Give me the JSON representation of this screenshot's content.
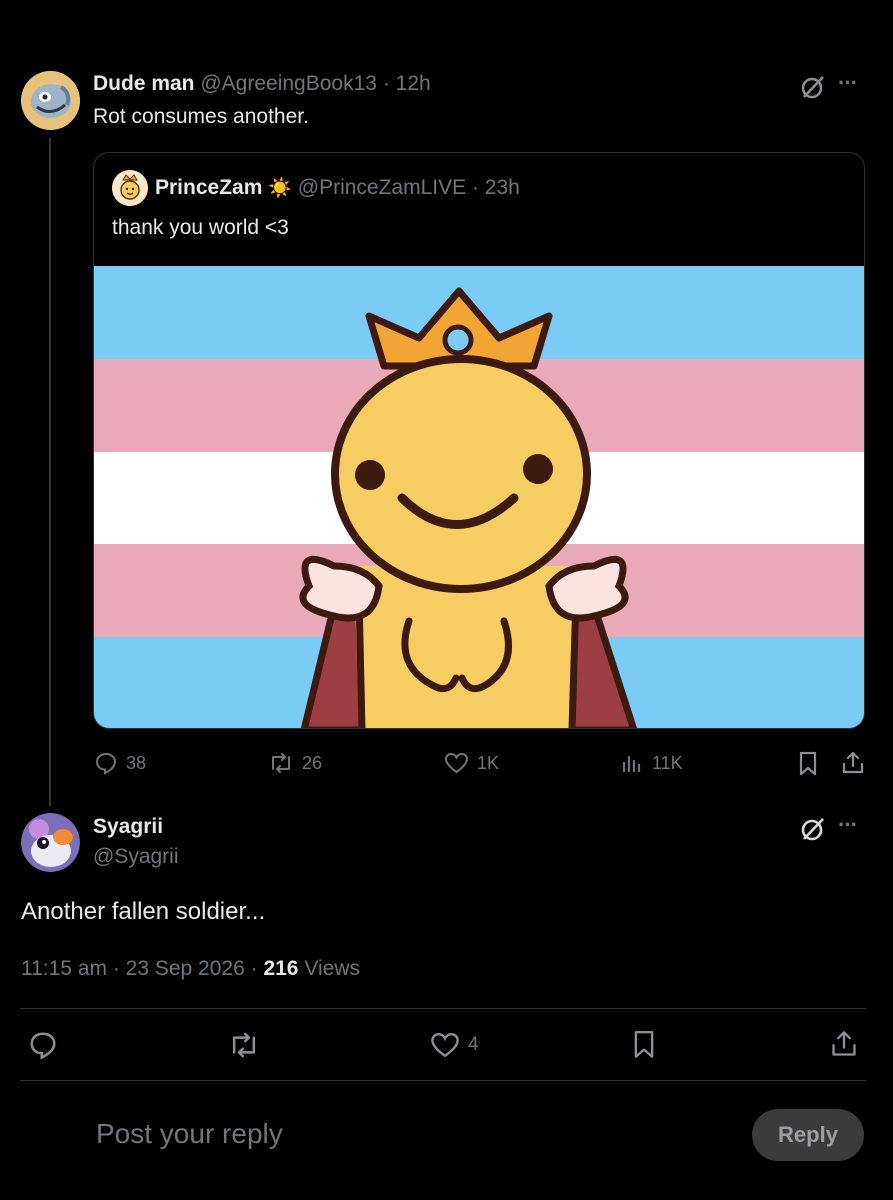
{
  "parent_post": {
    "display_name": "Dude man",
    "handle": "@AgreeingBook13",
    "time": "· 12h",
    "text": "Rot consumes another.",
    "more_label": "···",
    "quoted_post": {
      "display_name": "PrinceZam",
      "badge": "☀️",
      "handle": "@PrinceZamLIVE",
      "time": "· 23h",
      "text": "thank you world <3",
      "image_colors": {
        "blue": "#7acbf5",
        "pink": "#eaa9b9",
        "white": "#ffffff"
      }
    },
    "metrics": {
      "replies": "38",
      "reposts": "26",
      "likes": "1K",
      "views": "11K"
    }
  },
  "main_post": {
    "display_name": "Syagrii",
    "handle": "@Syagrii",
    "more_label": "···",
    "text": "Another fallen soldier...",
    "timestamp": "11:15 am · 23 Sep 2026 ·",
    "views_count": "216",
    "views_label": "Views",
    "likes": "4"
  },
  "reply_bar": {
    "placeholder": "Post your reply",
    "button_label": "Reply"
  }
}
